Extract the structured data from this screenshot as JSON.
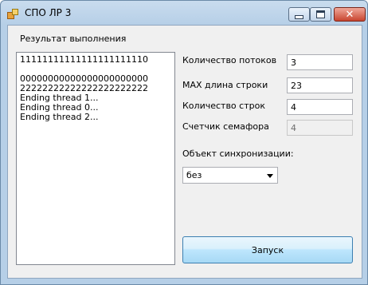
{
  "window": {
    "title": "СПО ЛР 3"
  },
  "result": {
    "label": "Результат выполнения",
    "lines": [
      "11111111111111111111110",
      "",
      "00000000000000000000000",
      "22222222222222222222222",
      "Ending thread 1...",
      "Ending thread 0...",
      "Ending thread 2..."
    ]
  },
  "fields": {
    "threads": {
      "label": "Количество потоков",
      "value": "3"
    },
    "max_length": {
      "label": "MAX длина строки",
      "value": "23"
    },
    "rows": {
      "label": "Количество строк",
      "value": "4"
    },
    "semaphore": {
      "label": "Счетчик семафора",
      "value": "4"
    }
  },
  "sync": {
    "label": "Объект синхронизации:",
    "selected": "без"
  },
  "run_button": {
    "label": "Запуск"
  },
  "icons": {
    "app": "app-icon",
    "minimize": "minimize-icon",
    "maximize": "maximize-icon",
    "close": "close-icon",
    "dropdown": "chevron-down-icon"
  }
}
